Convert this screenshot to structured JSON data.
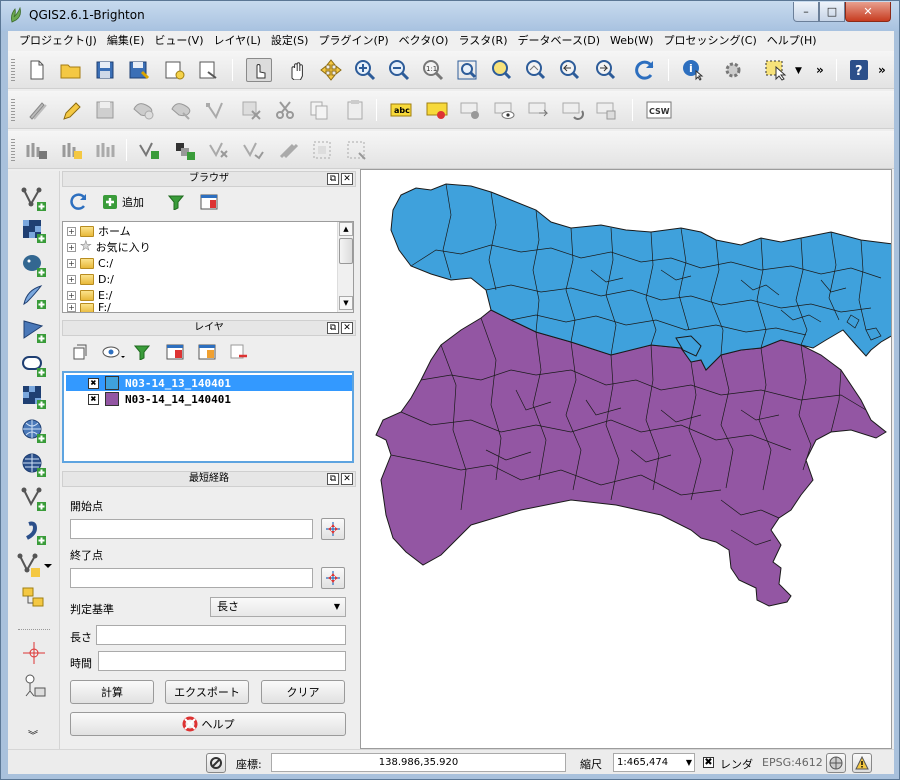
{
  "window": {
    "title": "QGIS2.6.1-Brighton",
    "min": "–",
    "max": "□",
    "close": "✕"
  },
  "menubar": [
    "プロジェクト(J)",
    "編集(E)",
    "ビュー(V)",
    "レイヤ(L)",
    "設定(S)",
    "プラグイン(P)",
    "ベクタ(O)",
    "ラスタ(R)",
    "データベース(D)",
    "Web(W)",
    "プロセッシング(C)",
    "ヘルプ(H)"
  ],
  "toolbar": {
    "overflow": "»",
    "csw_label": "CSW",
    "abc_label": "abc"
  },
  "browser_panel": {
    "title": "ブラウザ",
    "add_label": "追加",
    "items": [
      "ホーム",
      "お気に入り",
      "C:/",
      "D:/",
      "E:/",
      "F:/"
    ]
  },
  "layers_panel": {
    "title": "レイヤ",
    "layers": [
      {
        "name": "N03-14_13_140401",
        "color": "#3fa1dc",
        "checked": "✖",
        "selected": true
      },
      {
        "name": "N03-14_14_140401",
        "color": "#9356a3",
        "checked": "✖",
        "selected": false
      }
    ]
  },
  "shortest_path_panel": {
    "title": "最短経路",
    "start_label": "開始点",
    "start_value": "",
    "end_label": "終了点",
    "end_value": "",
    "criterion_label": "判定基準",
    "criterion_value": "長さ",
    "length_label": "長さ",
    "length_value": "",
    "time_label": "時間",
    "time_value": "",
    "calc_label": "計算",
    "export_label": "エクスポート",
    "clear_label": "クリア",
    "help_label": "ヘルプ"
  },
  "statusbar": {
    "coord_label": "座標:",
    "coord_value": "138.986,35.920",
    "scale_label": "縮尺",
    "scale_value": "1:465,474",
    "render_label": "レンダ",
    "render_checked": "✖",
    "crs": "EPSG:4612"
  },
  "colors": {
    "tokyo": "#3fa1dc",
    "kanagawa": "#9356a3",
    "selection": "#3399ff"
  }
}
